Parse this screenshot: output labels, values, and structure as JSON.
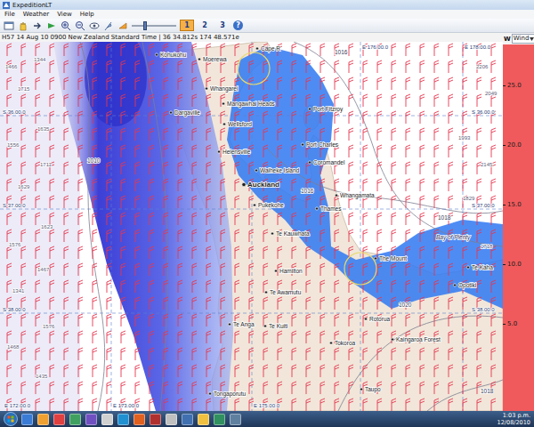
{
  "window": {
    "title": "ExpeditionLT"
  },
  "menu": [
    "File",
    "Weather",
    "View",
    "Help"
  ],
  "toolbar": {
    "pages": [
      {
        "label": "1",
        "selected": true
      },
      {
        "label": "2",
        "selected": false
      },
      {
        "label": "3",
        "selected": false
      }
    ],
    "help": "?",
    "slider": {
      "level": 0.3
    }
  },
  "status_bar": "H57 14 Aug 10 0900 New Zealand Standard Time | 36 34.812s 174 48.571e",
  "layer_panel": {
    "label": "W",
    "dropdown": "Wind",
    "scale": [
      "25.0",
      "20.0",
      "15.0",
      "10.0",
      "5.0"
    ]
  },
  "map": {
    "places": [
      {
        "name": "Cape R",
        "kind": "town"
      },
      {
        "name": "Kohukohu",
        "kind": "town"
      },
      {
        "name": "Moerewa",
        "kind": "town"
      },
      {
        "name": "Whangarei",
        "kind": "town"
      },
      {
        "name": "Dargaville",
        "kind": "town"
      },
      {
        "name": "Mangawhai Heads",
        "kind": "town"
      },
      {
        "name": "Port Fitzroy",
        "kind": "town"
      },
      {
        "name": "Wellsford",
        "kind": "town"
      },
      {
        "name": "Helensville",
        "kind": "town"
      },
      {
        "name": "Port Charles",
        "kind": "town"
      },
      {
        "name": "Waiheke Island",
        "kind": "town"
      },
      {
        "name": "Coromandel",
        "kind": "town"
      },
      {
        "name": "Auckland",
        "kind": "city"
      },
      {
        "name": "Thames",
        "kind": "town"
      },
      {
        "name": "Whangamata",
        "kind": "town"
      },
      {
        "name": "Pukekohe",
        "kind": "town"
      },
      {
        "name": "Te Kauwhata",
        "kind": "town"
      },
      {
        "name": "Hamilton",
        "kind": "town"
      },
      {
        "name": "Te Awamutu",
        "kind": "town"
      },
      {
        "name": "Te Kuiti",
        "kind": "town"
      },
      {
        "name": "Te Anga",
        "kind": "town"
      },
      {
        "name": "Tongaporutu",
        "kind": "town"
      },
      {
        "name": "The Mount",
        "kind": "town"
      },
      {
        "name": "Bay of Plenty",
        "kind": "region"
      },
      {
        "name": "Te Kaha",
        "kind": "town"
      },
      {
        "name": "Opotiki",
        "kind": "town"
      },
      {
        "name": "Rotorua",
        "kind": "town"
      },
      {
        "name": "Tokoroa",
        "kind": "town"
      },
      {
        "name": "Kaingaroa Forest",
        "kind": "town"
      },
      {
        "name": "Taupo",
        "kind": "town"
      }
    ],
    "isobar_labels": [
      "1016",
      "1016",
      "1018",
      "1020",
      "1010",
      "1018"
    ],
    "depths": [
      "1466",
      "1344",
      "1715",
      "1635",
      "1556",
      "1711",
      "1629",
      "1623",
      "1576",
      "1467",
      "1341",
      "1576",
      "1468",
      "1435",
      "2206",
      "2049",
      "1993",
      "2145",
      "1829",
      "1718"
    ],
    "grid_labels": {
      "lat_left": [
        "S 36.00.0",
        "S 37.00.0",
        "S 38.00.0"
      ],
      "lat_right": [
        "S 36.00.0",
        "S 37.00.0",
        "S 38.00.0"
      ],
      "lon_top": [
        "E 176.00.0",
        "E 178.00.0"
      ],
      "lon_bottom": [
        "E 172.00.0",
        "E 173.00.0",
        "E 175.00.0"
      ]
    },
    "wind_barbs": {
      "feathers": 2
    }
  },
  "taskbar": {
    "time": "1:03 p.m.",
    "date": "12/08/2010"
  }
}
